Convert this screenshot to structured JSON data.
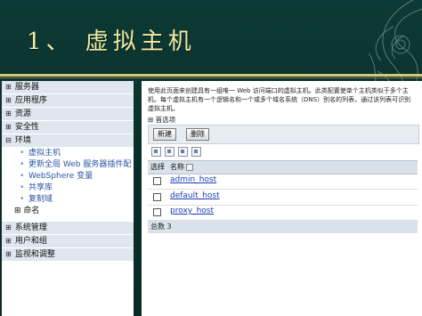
{
  "slide": {
    "title": "1、 虚拟主机"
  },
  "nav": {
    "sections_top": [
      {
        "sign": "⊞",
        "label": "服务器"
      },
      {
        "sign": "⊞",
        "label": "应用程序"
      },
      {
        "sign": "⊞",
        "label": "资源"
      },
      {
        "sign": "⊞",
        "label": "安全性"
      },
      {
        "sign": "⊟",
        "label": "环境"
      }
    ],
    "env_items": [
      {
        "label": "虚拟主机"
      },
      {
        "label": "更新全局 Web 服务器插件配"
      },
      {
        "label": "WebSphere 变量"
      },
      {
        "label": "共享库"
      },
      {
        "label": "复制域"
      }
    ],
    "naming": {
      "sign": "⊞",
      "label": "命名"
    },
    "sections_bottom": [
      {
        "sign": "⊞",
        "label": "系统管理"
      },
      {
        "sign": "⊞",
        "label": "用户和组"
      },
      {
        "sign": "⊞",
        "label": "监视和调整"
      }
    ]
  },
  "panel": {
    "description": "使用此页面来创建具有一组唯一 Web 访问端口的虚拟主机。此类配置使单个主机类似于多个主机。每个虚拟主机有一个逻辑名和一个或多个域名系统（DNS）别名的列表，通过该列表可识别虚拟主机。",
    "preferences": "⊞ 首选项",
    "buttons": {
      "new": "新建",
      "delete": "删除"
    },
    "table": {
      "col_select": "选择",
      "col_name": "名称",
      "rows": [
        {
          "name": "admin_host"
        },
        {
          "name": "default_host"
        },
        {
          "name": "proxy_host"
        }
      ],
      "total": "总数 3"
    }
  }
}
